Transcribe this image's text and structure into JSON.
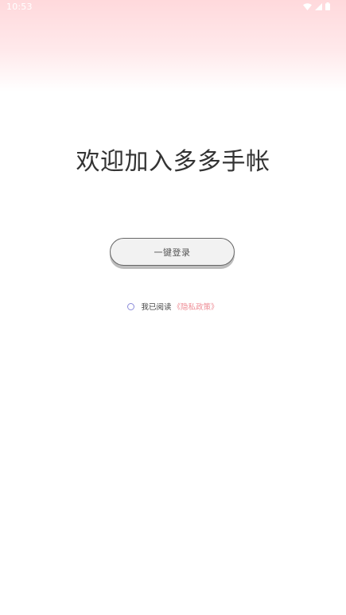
{
  "status_bar": {
    "time": "10:53",
    "icons": [
      "wifi-icon",
      "signal-icon",
      "battery-icon"
    ]
  },
  "title": "欢迎加入多多手帐",
  "login_button": {
    "label": "一键登录"
  },
  "agreement": {
    "text": "我已阅读",
    "privacy_link": "《隐私政策》"
  },
  "colors": {
    "header_gradient_top": "#ffd9dc",
    "link": "#ee8c95",
    "radio_border": "#8c8cd9",
    "button_bg": "#f2f2f2",
    "button_border": "#666666"
  }
}
